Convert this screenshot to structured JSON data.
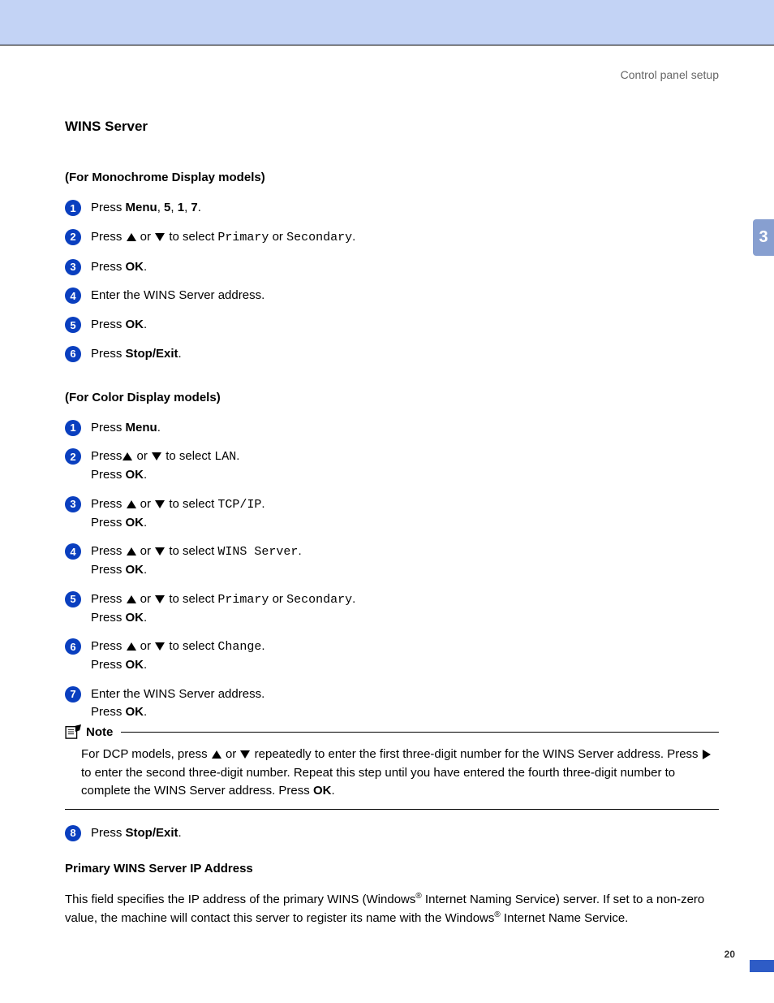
{
  "header": {
    "right_label": "Control panel setup"
  },
  "side_tab": "3",
  "page_number": "20",
  "section_title": "WINS Server",
  "mono_heading": "(For Monochrome Display models)",
  "mono_steps": {
    "s1": {
      "pre": "Press ",
      "bold": "Menu",
      "post": ", ",
      "b2": "5",
      "c2": ", ",
      "b3": "1",
      "c3": ", ",
      "b4": "7",
      "end": "."
    },
    "s2": {
      "pre": "Press ",
      "mid": " or ",
      "post1": " to select ",
      "m1": "Primary",
      "or": " or ",
      "m2": "Secondary",
      "end": "."
    },
    "s3": {
      "pre": "Press ",
      "bold": "OK",
      "end": "."
    },
    "s4": {
      "text": "Enter the WINS Server address."
    },
    "s5": {
      "pre": "Press ",
      "bold": "OK",
      "end": "."
    },
    "s6": {
      "pre": "Press ",
      "bold": "Stop/Exit",
      "end": "."
    }
  },
  "color_heading": "(For Color Display models)",
  "color_steps": {
    "s1": {
      "pre": "Press ",
      "bold": "Menu",
      "end": "."
    },
    "s2": {
      "pre": "Press",
      "mid": " or ",
      "post1": " to select ",
      "m1": "LAN",
      "end": ".",
      "line2a": "Press ",
      "line2b": "OK",
      "line2c": "."
    },
    "s3": {
      "pre": "Press ",
      "mid": " or ",
      "post1": " to select ",
      "m1": "TCP/IP",
      "end": ".",
      "line2a": "Press ",
      "line2b": "OK",
      "line2c": "."
    },
    "s4": {
      "pre": "Press ",
      "mid": " or ",
      "post1": " to select ",
      "m1": "WINS Server",
      "end": ".",
      "line2a": "Press ",
      "line2b": "OK",
      "line2c": "."
    },
    "s5": {
      "pre": "Press ",
      "mid": " or ",
      "post1": " to select ",
      "m1": "Primary",
      "or": " or ",
      "m2": "Secondary",
      "end": ".",
      "line2a": "Press ",
      "line2b": "OK",
      "line2c": "."
    },
    "s6": {
      "pre": "Press ",
      "mid": " or ",
      "post1": " to select ",
      "m1": "Change",
      "end": ".",
      "line2a": "Press ",
      "line2b": "OK",
      "line2c": "."
    },
    "s7": {
      "line1": "Enter the WINS Server address.",
      "line2a": "Press ",
      "line2b": "OK",
      "line2c": "."
    },
    "s8": {
      "pre": "Press ",
      "bold": "Stop/Exit",
      "end": "."
    }
  },
  "note": {
    "label": "Note",
    "t1": "For DCP models, press ",
    "t2": " or ",
    "t3": " repeatedly to enter the first three-digit number for the WINS Server address. Press ",
    "t4": " to enter the second three-digit number. Repeat this step until you have entered the fourth three-digit number to complete the WINS Server address. Press ",
    "b1": "OK",
    "t5": "."
  },
  "primary_heading": "Primary WINS Server IP Address",
  "primary_para": {
    "t1": "This field specifies the IP address of the primary WINS (Windows",
    "sup": "®",
    "t2": " Internet Naming Service) server. If set to a non-zero value, the machine will contact this server to register its name with the Windows",
    "t3": " Internet Name Service."
  }
}
